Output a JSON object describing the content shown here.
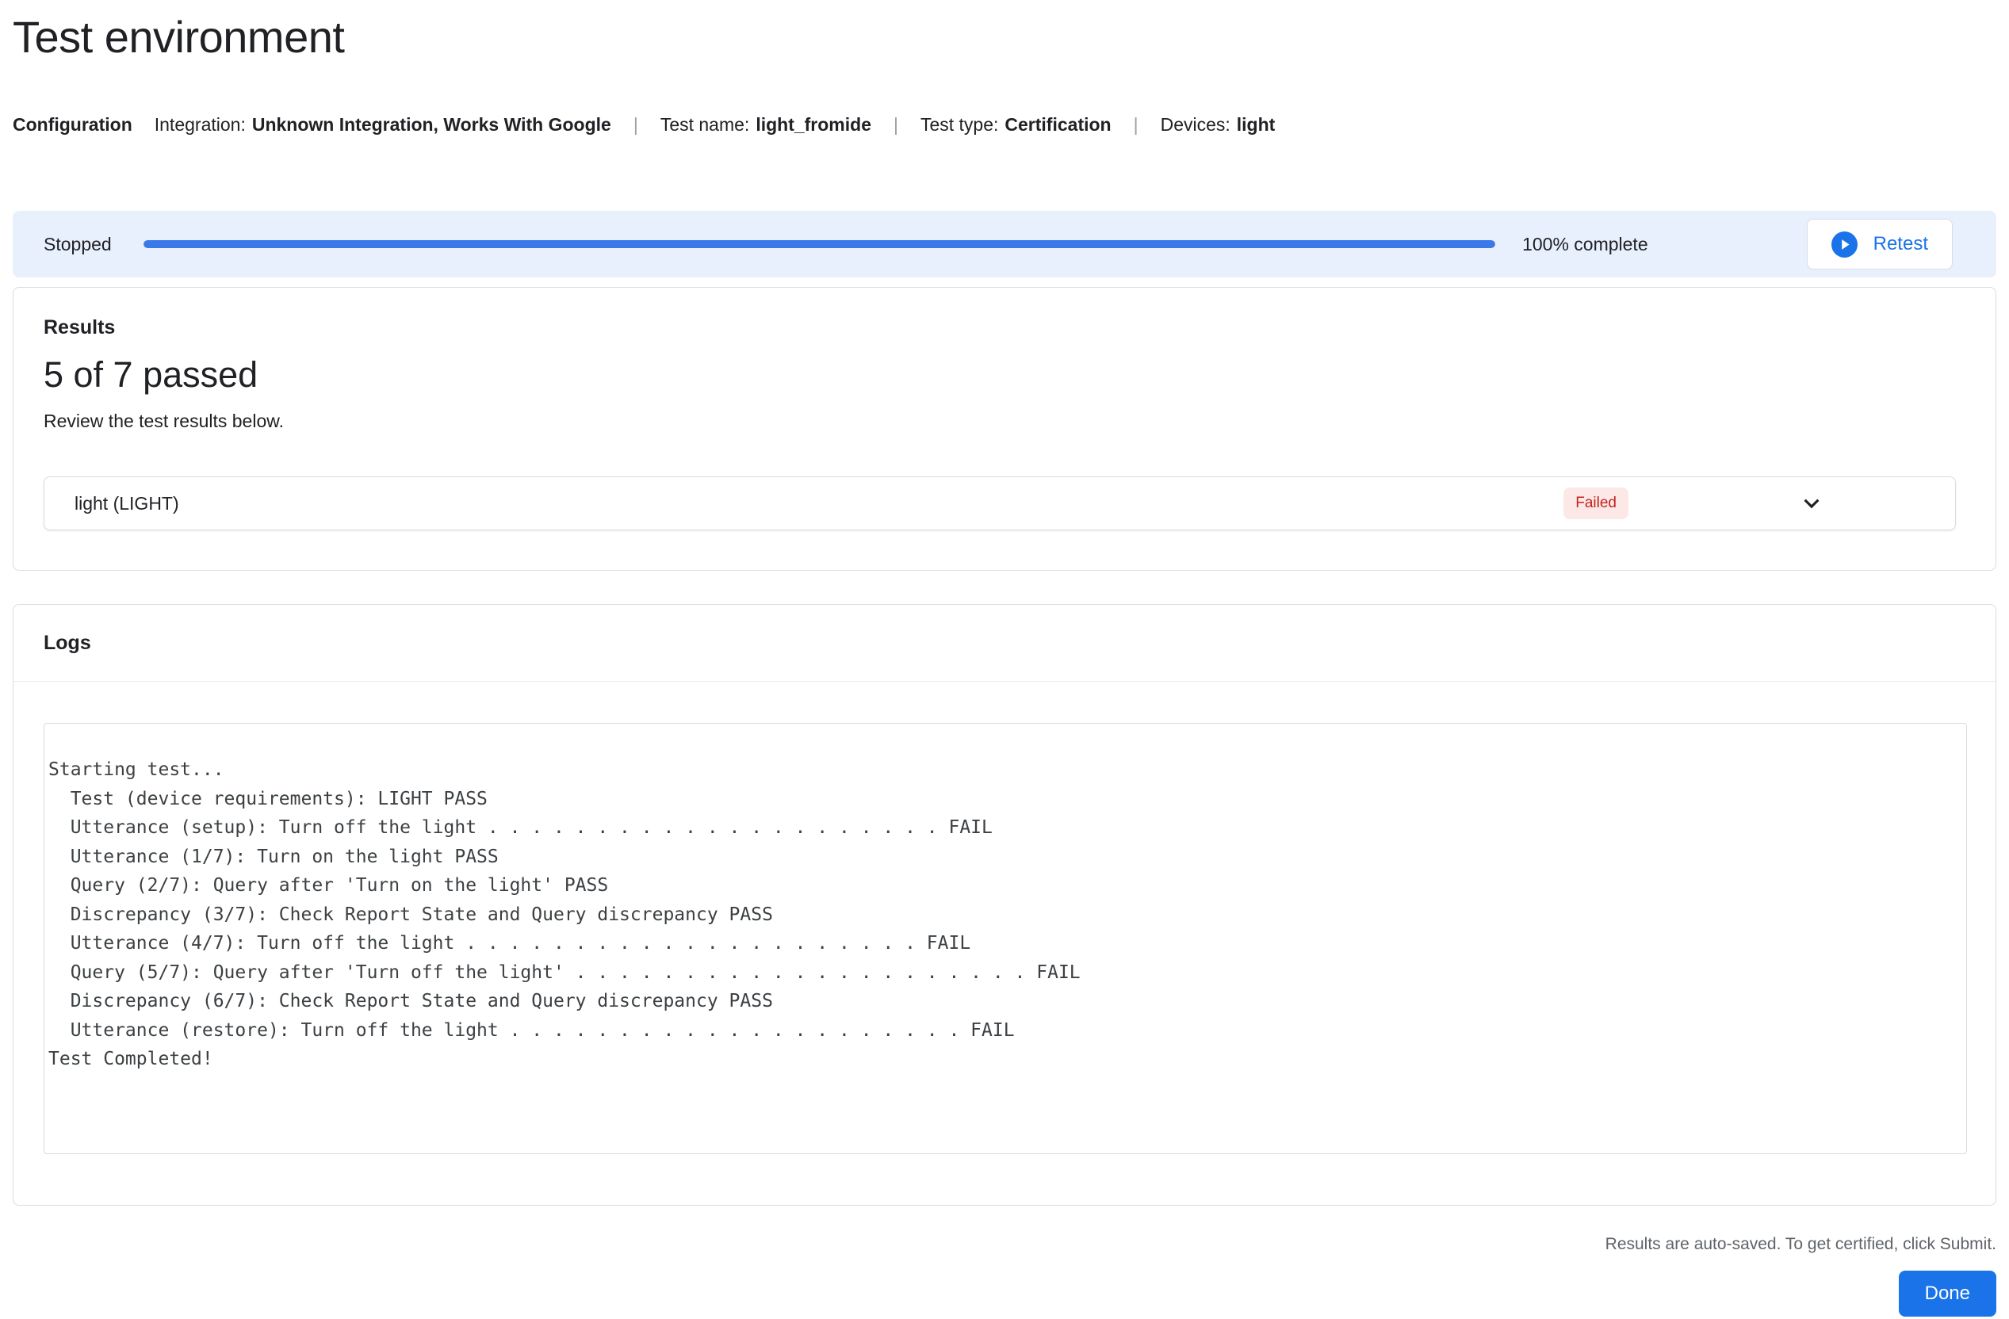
{
  "page": {
    "title": "Test environment"
  },
  "config": {
    "section_label": "Configuration",
    "separator": "|",
    "items": [
      {
        "label": "Integration:",
        "value": "Unknown Integration, Works With Google"
      },
      {
        "label": "Test name:",
        "value": "light_fromide"
      },
      {
        "label": "Test type:",
        "value": "Certification"
      },
      {
        "label": "Devices:",
        "value": "light"
      }
    ]
  },
  "progress": {
    "status": "Stopped",
    "percent": 100,
    "complete_label": "100% complete",
    "retest_label": "Retest"
  },
  "results": {
    "heading": "Results",
    "summary": "5 of 7 passed",
    "description": "Review the test results below.",
    "rows": [
      {
        "device": "light (LIGHT)",
        "status": "Failed"
      }
    ]
  },
  "logs": {
    "heading": "Logs",
    "lines": [
      "Starting test...",
      "  Test (device requirements): LIGHT PASS",
      "  Utterance (setup): Turn off the light . . . . . . . . . . . . . . . . . . . . . FAIL",
      "  Utterance (1/7): Turn on the light PASS",
      "  Query (2/7): Query after 'Turn on the light' PASS",
      "  Discrepancy (3/7): Check Report State and Query discrepancy PASS",
      "  Utterance (4/7): Turn off the light . . . . . . . . . . . . . . . . . . . . . FAIL",
      "  Query (5/7): Query after 'Turn off the light' . . . . . . . . . . . . . . . . . . . . . FAIL",
      "  Discrepancy (6/7): Check Report State and Query discrepancy PASS",
      "  Utterance (restore): Turn off the light . . . . . . . . . . . . . . . . . . . . . FAIL",
      "Test Completed!"
    ]
  },
  "footer": {
    "autosave_note": "Results are auto-saved. To get certified, click Submit.",
    "done_label": "Done"
  },
  "colors": {
    "accent_blue": "#1a73e8",
    "progress_blue": "#3b78e8",
    "banner_background": "#e8f0fe",
    "failed_badge_background": "#fce8e6",
    "failed_badge_text": "#c5221f",
    "border": "#dadce0",
    "text_primary": "#202124",
    "text_secondary": "#5f6368"
  }
}
